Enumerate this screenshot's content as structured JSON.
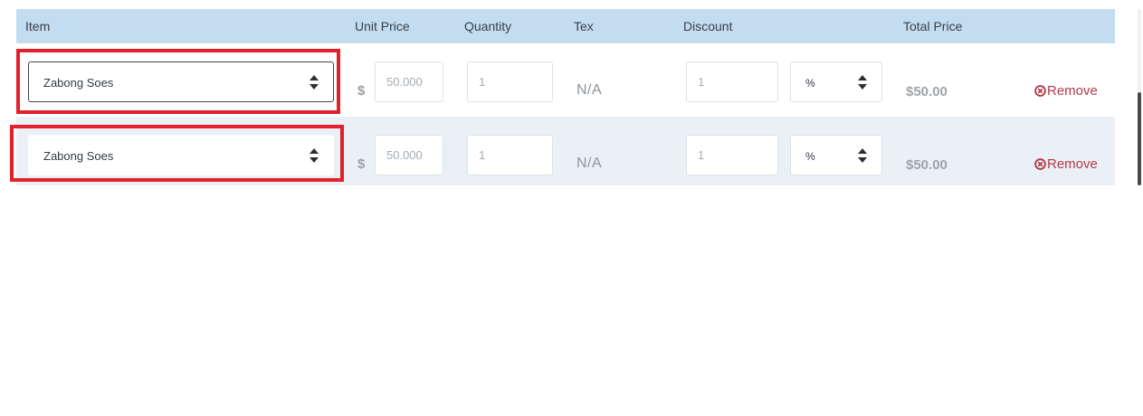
{
  "table": {
    "headers": {
      "item": "Item",
      "unit_price": "Unit Price",
      "quantity": "Quantity",
      "tax": "Tex",
      "discount": "Discount",
      "total_price": "Total Price"
    },
    "rows": [
      {
        "item": "Zabong Soes",
        "currency": "$",
        "unit_price": "50.000",
        "quantity": "1",
        "tax": "N/A",
        "discount": "1",
        "discount_type": "%",
        "total": "$50.00",
        "remove_label": "Remove",
        "highlighted": true
      },
      {
        "item": "Zabong Soes",
        "currency": "$",
        "unit_price": "50.000",
        "quantity": "1",
        "tax": "N/A",
        "discount": "1",
        "discount_type": "%",
        "total": "$50.00",
        "remove_label": "Remove",
        "highlighted": true
      }
    ]
  },
  "colors": {
    "header_bg": "#c3dcef",
    "row_alt_bg": "#eaf0f5",
    "highlight": "#e3212b",
    "remove": "#b23a4a"
  },
  "icons": {
    "select_arrow": "updown-icon",
    "remove": "circle-x-icon"
  }
}
